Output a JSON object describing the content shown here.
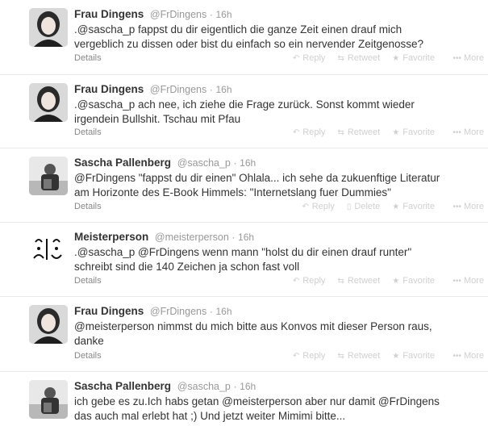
{
  "tweets": [
    {
      "name": "Frau Dingens",
      "handle": "@FrDingens",
      "sep": "·",
      "time": "16h",
      "text": ".@sascha_p fappst du dir eigentlich die ganze Zeit einen drauf mich\nvergeblich zu dissen oder bist du einfach so ein nervender Zeitgenosse?",
      "details": "Details",
      "actions": [
        "Reply",
        "Retweet",
        "Favorite",
        "More"
      ],
      "avatar_icon": "woman-avatar-icon"
    },
    {
      "name": "Frau Dingens",
      "handle": "@FrDingens",
      "sep": "·",
      "time": "16h",
      "text": ".@sascha_p ach nee, ich ziehe die Frage zurück. Sonst kommt wieder\nirgendein Bullshit. Tschau mit Pfau",
      "details": "Details",
      "actions": [
        "Reply",
        "Retweet",
        "Favorite",
        "More"
      ],
      "avatar_icon": "woman-avatar-icon"
    },
    {
      "name": "Sascha Pallenberg",
      "handle": "@sascha_p",
      "sep": "·",
      "time": "16h",
      "text": "@FrDingens \"fappst du dir einen\" Ohlala... ich sehe da zukuenftige Literatur\nam Horizonte des E-Book Himmels: \"Internetslang fuer Dummies\"",
      "details": "Details",
      "actions": [
        "Reply",
        "Delete",
        "Favorite",
        "More"
      ],
      "avatar_icon": "man-avatar-icon"
    },
    {
      "name": "Meisterperson",
      "handle": "@meisterperson",
      "sep": "·",
      "time": "16h",
      "text": ".@sascha_p @FrDingens wenn mann \"holst du dir einen drauf runter\"\nschreibt sind die 140 Zeichen ja schon fast voll",
      "details": "Details",
      "actions": [
        "Reply",
        "Retweet",
        "Favorite",
        "More"
      ],
      "avatar_icon": "doodle-avatar-icon"
    },
    {
      "name": "Frau Dingens",
      "handle": "@FrDingens",
      "sep": "·",
      "time": "16h",
      "text": "@meisterperson nimmst du mich bitte aus Konvos mit dieser Person raus,\ndanke",
      "details": "Details",
      "actions": [
        "Reply",
        "Retweet",
        "Favorite",
        "More"
      ],
      "avatar_icon": "woman-avatar-icon"
    },
    {
      "name": "Sascha Pallenberg",
      "handle": "@sascha_p",
      "sep": "·",
      "time": "16h",
      "text": "ich gebe es zu.Ich habs getan @meisterperson aber nur damit @FrDingens\ndas auch mal erlebt hat ;) Und jetzt weiter Mimimi bitte...",
      "details": "",
      "actions": [],
      "avatar_icon": "man-avatar-icon"
    }
  ],
  "colors": {
    "text": "#333333",
    "muted": "#999999",
    "action": "#d0d0d0",
    "divider": "#e8e8e8"
  }
}
